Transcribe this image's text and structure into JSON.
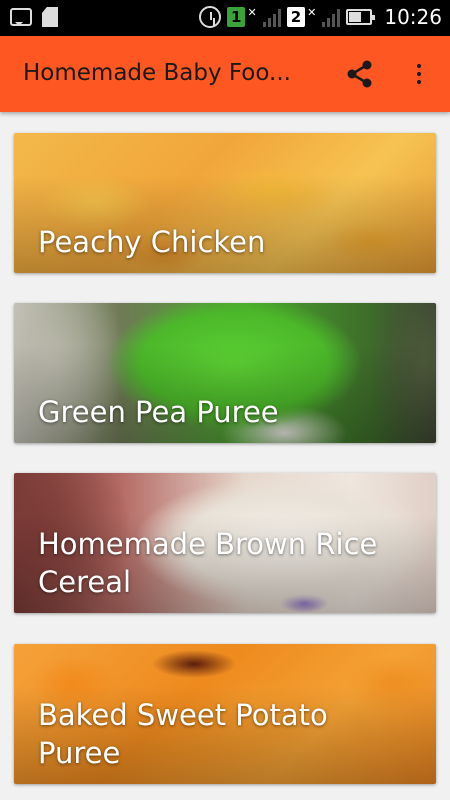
{
  "status_bar": {
    "time": "10:26",
    "sim1": "1",
    "sim2": "2"
  },
  "app_bar": {
    "title": "Homemade Baby Foo..."
  },
  "recipes": [
    {
      "title": "Peachy Chicken"
    },
    {
      "title": "Green Pea Puree"
    },
    {
      "title": "Homemade Brown Rice Cereal"
    },
    {
      "title": "Baked Sweet Potato Puree"
    }
  ],
  "colors": {
    "app_bar": "#ff5722",
    "background": "#f1f1f1",
    "status_bar": "#000000"
  },
  "icons": {
    "share": "share-icon",
    "overflow": "more-vert-icon"
  }
}
